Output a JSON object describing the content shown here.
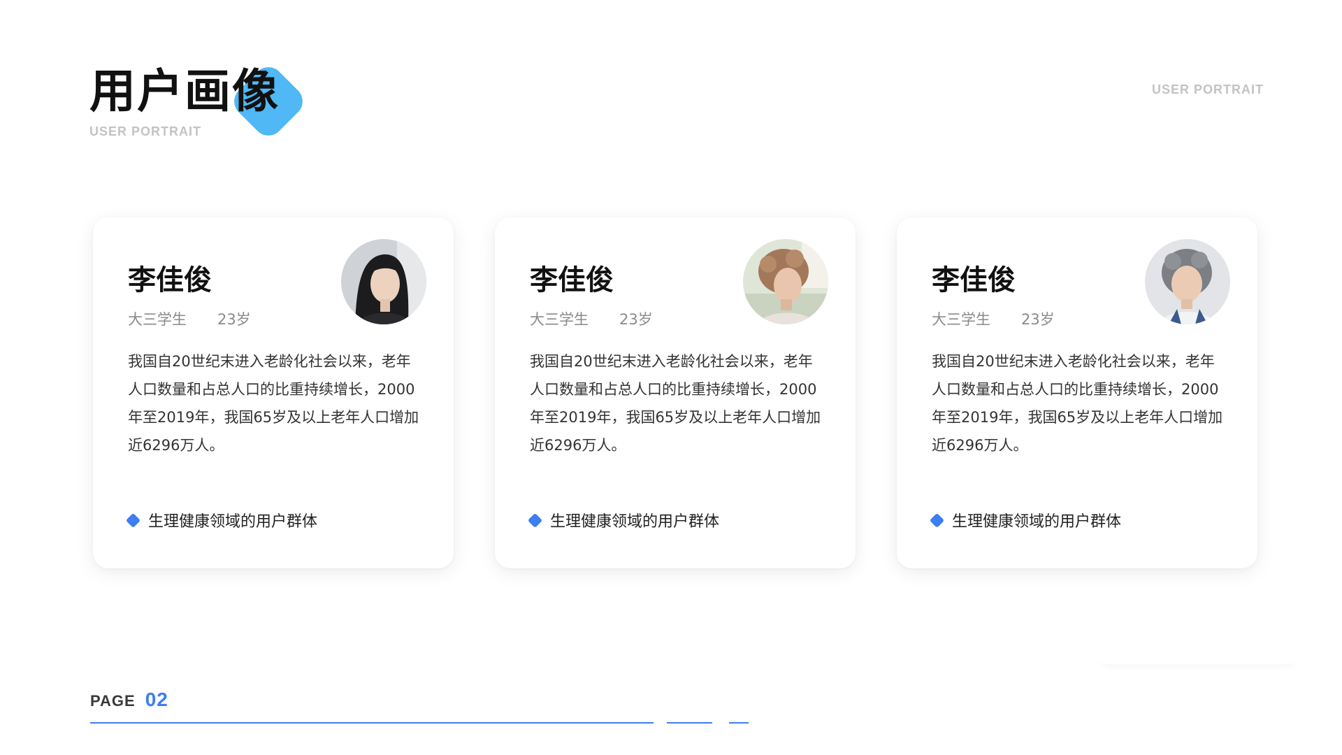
{
  "header": {
    "title": "用户画像",
    "subtitle": "USER PORTRAIT",
    "top_right_label": "USER PORTRAIT",
    "accent_color": "#4fb8f5"
  },
  "cards": [
    {
      "name": "李佳俊",
      "role": "大三学生",
      "age": "23岁",
      "description": "我国自20世纪末进入老龄化社会以来，老年人口数量和占总人口的比重持续增长，2000年至2019年，我国65岁及以上老年人口增加近6296万人。",
      "tag": "生理健康领域的用户群体",
      "avatar": "young-woman-portrait"
    },
    {
      "name": "李佳俊",
      "role": "大三学生",
      "age": "23岁",
      "description": "我国自20世纪末进入老龄化社会以来，老年人口数量和占总人口的比重持续增长，2000年至2019年，我国65岁及以上老年人口增加近6296万人。",
      "tag": "生理健康领域的用户群体",
      "avatar": "older-woman-portrait"
    },
    {
      "name": "李佳俊",
      "role": "大三学生",
      "age": "23岁",
      "description": "我国自20世纪末进入老龄化社会以来，老年人口数量和占总人口的比重持续增长，2000年至2019年，我国65岁及以上老年人口增加近6296万人。",
      "tag": "生理健康领域的用户群体",
      "avatar": "gray-haired-woman-portrait"
    }
  ],
  "footer": {
    "page_label": "PAGE",
    "page_number": "02",
    "accent_color": "#3d7ef0"
  }
}
